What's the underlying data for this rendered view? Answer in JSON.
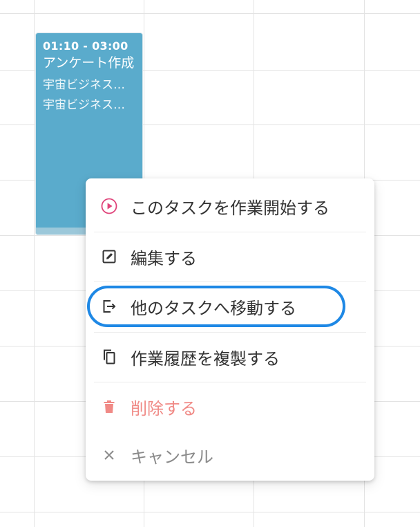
{
  "event": {
    "time": "01:10 - 03:00",
    "title": "アンケート作成",
    "sub1": "宇宙ビジネス…",
    "sub2": "宇宙ビジネス…",
    "color": "#5aabcc"
  },
  "menu": {
    "items": [
      {
        "label": "このタスクを作業開始する",
        "icon": "play-circle-icon"
      },
      {
        "label": "編集する",
        "icon": "edit-icon"
      },
      {
        "label": "他のタスクへ移動する",
        "icon": "move-out-icon",
        "highlighted": true
      },
      {
        "label": "作業履歴を複製する",
        "icon": "copy-icon"
      },
      {
        "label": "削除する",
        "icon": "trash-icon",
        "color": "#f08a86"
      },
      {
        "label": "キャンセル",
        "icon": "close-icon",
        "color": "#8a8a8a"
      }
    ],
    "highlight_color": "#1e88e5",
    "play_icon_color": "#e0457b"
  }
}
